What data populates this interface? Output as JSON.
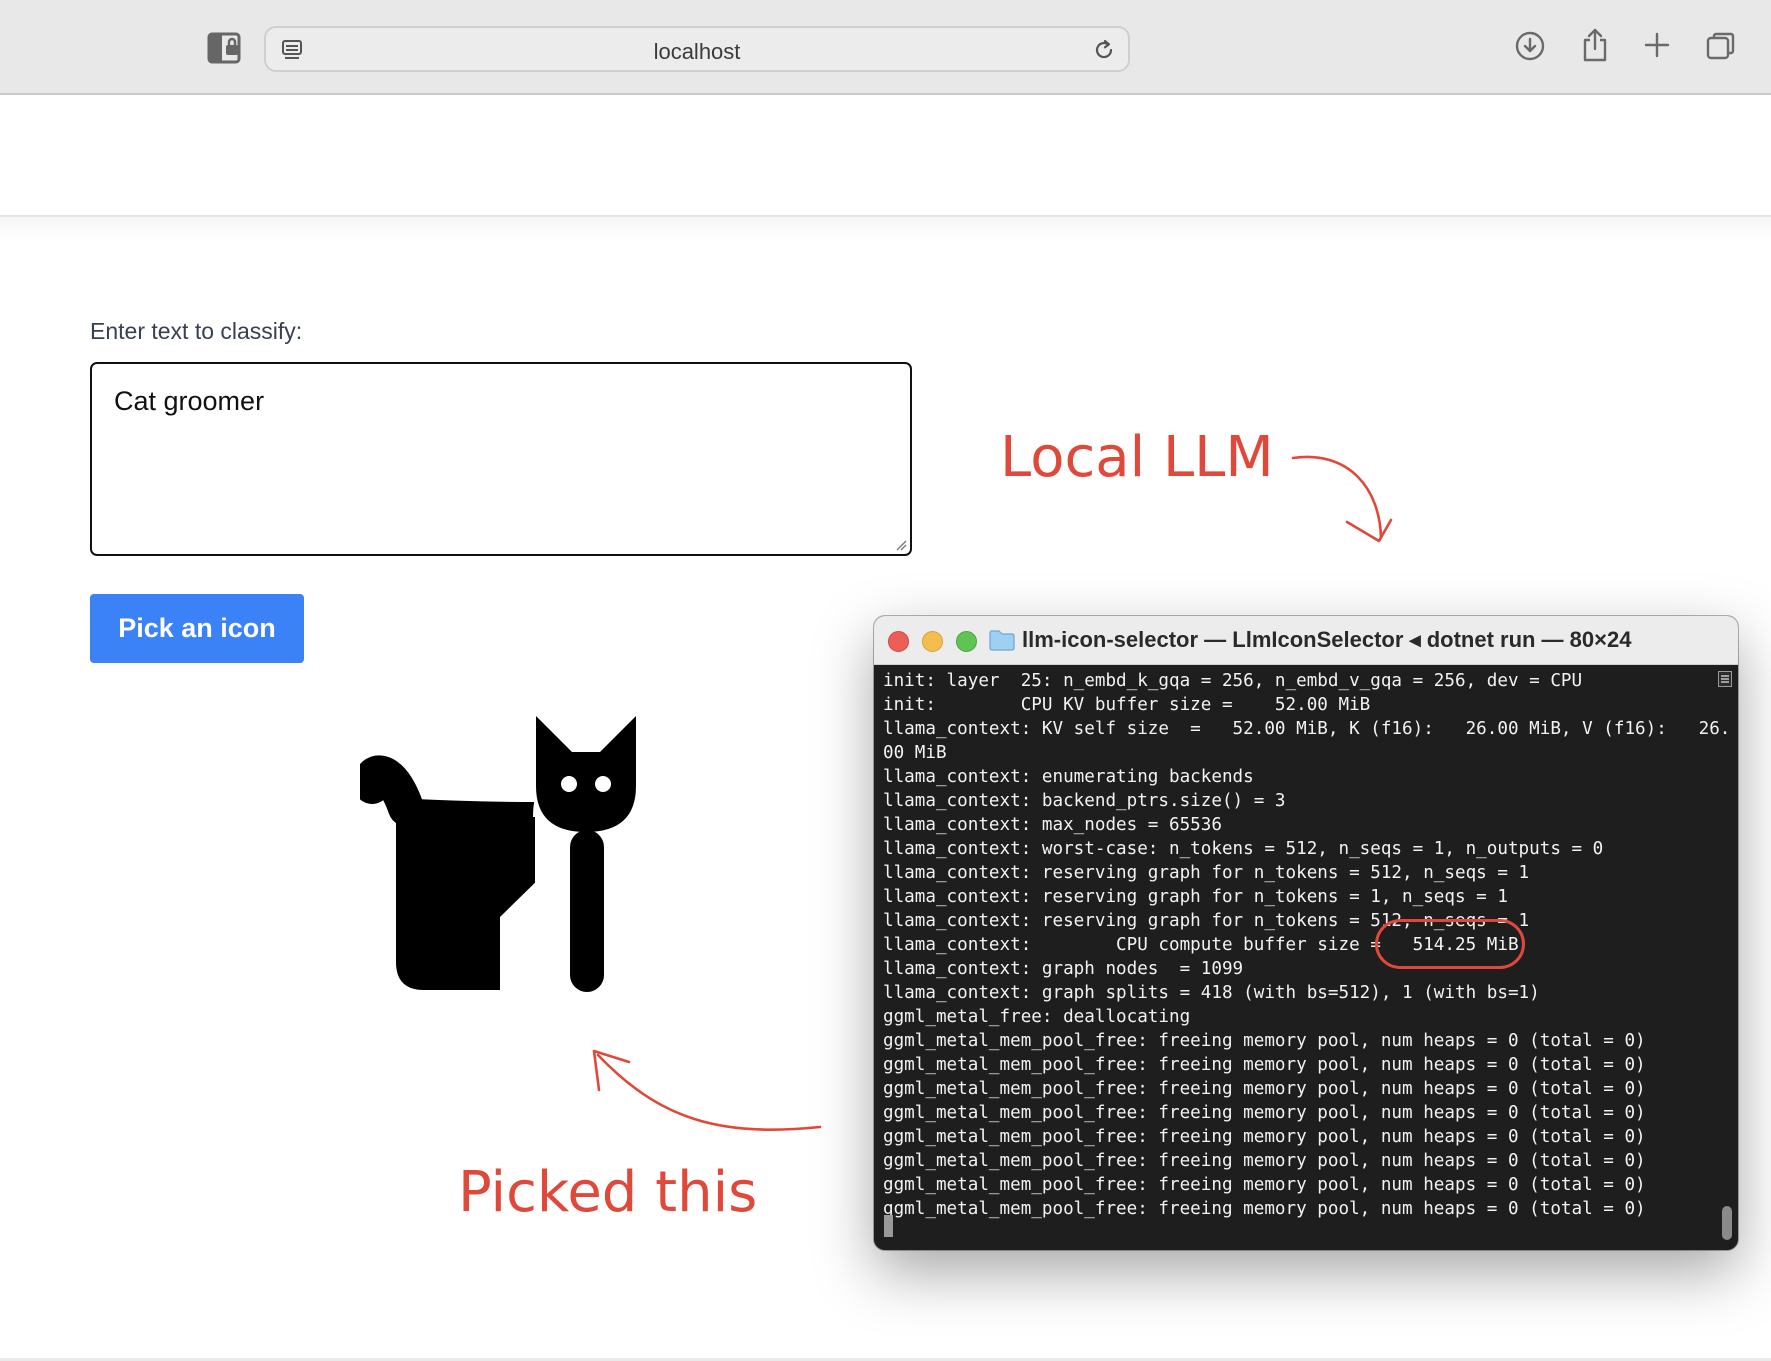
{
  "browser": {
    "url": "localhost"
  },
  "page": {
    "label": "Enter text to classify:",
    "input_value": "Cat groomer",
    "button_label": "Pick an icon",
    "result_icon": "cat-icon"
  },
  "annotations": {
    "local_llm": "Local LLM",
    "picked_this": "Picked this",
    "color": "#e0493a"
  },
  "terminal": {
    "title": "llm-icon-selector — LlmIconSelector ◂ dotnet run — 80×24",
    "lines": [
      "init: layer  25: n_embd_k_gqa = 256, n_embd_v_gqa = 256, dev = CPU",
      "init:        CPU KV buffer size =    52.00 MiB",
      "llama_context: KV self size  =   52.00 MiB, K (f16):   26.00 MiB, V (f16):   26.",
      "00 MiB",
      "llama_context: enumerating backends",
      "llama_context: backend_ptrs.size() = 3",
      "llama_context: max_nodes = 65536",
      "llama_context: worst-case: n_tokens = 512, n_seqs = 1, n_outputs = 0",
      "llama_context: reserving graph for n_tokens = 512, n_seqs = 1",
      "llama_context: reserving graph for n_tokens = 1, n_seqs = 1",
      "llama_context: reserving graph for n_tokens = 512, n_seqs = 1",
      "llama_context:        CPU compute buffer size =   514.25 MiB",
      "llama_context: graph nodes  = 1099",
      "llama_context: graph splits = 418 (with bs=512), 1 (with bs=1)",
      "ggml_metal_free: deallocating",
      "ggml_metal_mem_pool_free: freeing memory pool, num heaps = 0 (total = 0)",
      "ggml_metal_mem_pool_free: freeing memory pool, num heaps = 0 (total = 0)",
      "ggml_metal_mem_pool_free: freeing memory pool, num heaps = 0 (total = 0)",
      "ggml_metal_mem_pool_free: freeing memory pool, num heaps = 0 (total = 0)",
      "ggml_metal_mem_pool_free: freeing memory pool, num heaps = 0 (total = 0)",
      "ggml_metal_mem_pool_free: freeing memory pool, num heaps = 0 (total = 0)",
      "ggml_metal_mem_pool_free: freeing memory pool, num heaps = 0 (total = 0)",
      "ggml_metal_mem_pool_free: freeing memory pool, num heaps = 0 (total = 0)"
    ]
  },
  "colors": {
    "button": "#3b82f6",
    "terminal_bg": "#1e1e1e",
    "close": "#ec5f57",
    "minimize": "#f4be4f",
    "zoom": "#5fc454"
  }
}
